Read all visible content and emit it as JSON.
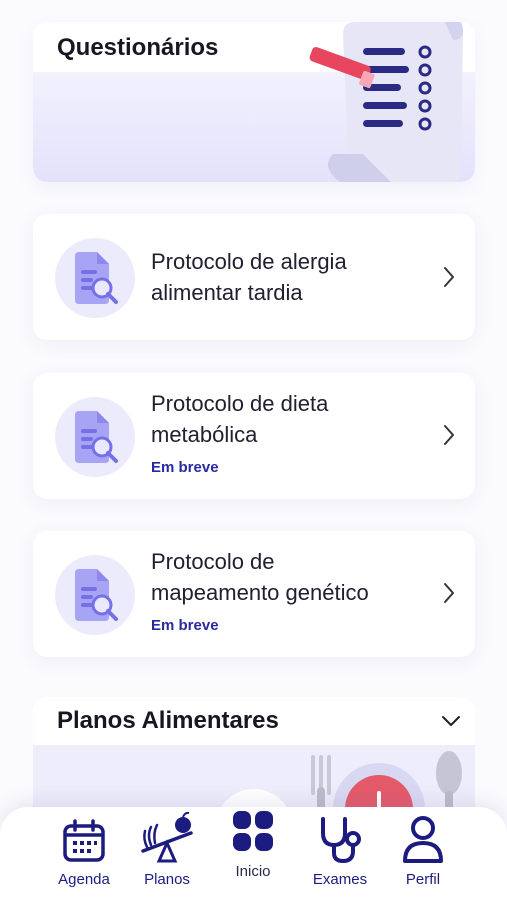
{
  "questionnaires": {
    "title": "Questionários",
    "cards": [
      {
        "title_line1": "Protocolo de alergia",
        "title_line2": "alimentar tardia",
        "status": ""
      },
      {
        "title_line1": "Protocolo de dieta",
        "title_line2": "metabólica",
        "status": "Em breve"
      },
      {
        "title_line1": "Protocolo de",
        "title_line2": "mapeamento genético",
        "status": "Em breve"
      }
    ]
  },
  "plans": {
    "title": "Planos Alimentares"
  },
  "bottom_nav": {
    "items": [
      {
        "label": "Agenda",
        "icon": "calendar-icon"
      },
      {
        "label": "Planos",
        "icon": "scale-icon"
      },
      {
        "label": "Inicio",
        "icon": "grid-icon",
        "active": true
      },
      {
        "label": "Exames",
        "icon": "stethoscope-icon"
      },
      {
        "label": "Perfil",
        "icon": "person-icon"
      }
    ]
  },
  "colors": {
    "accent": "#1c1c80",
    "soft": "#ecebfb",
    "illustration": "#8b86f0"
  }
}
